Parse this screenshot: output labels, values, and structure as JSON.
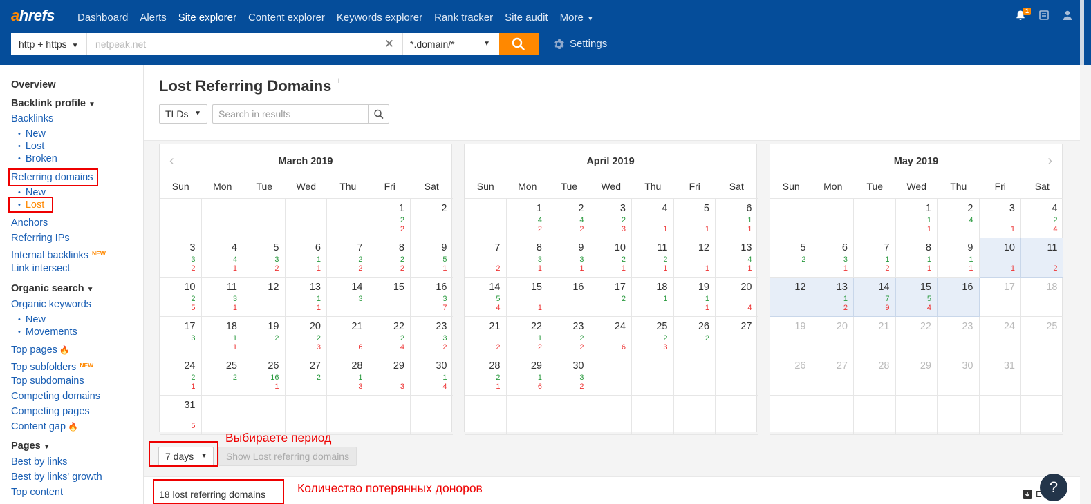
{
  "brand": {
    "logo_prefix": "a",
    "logo_rest": "hrefs"
  },
  "nav": [
    {
      "label": "Dashboard",
      "active": false
    },
    {
      "label": "Alerts",
      "active": false
    },
    {
      "label": "Site explorer",
      "active": true
    },
    {
      "label": "Content explorer",
      "active": false
    },
    {
      "label": "Keywords explorer",
      "active": false
    },
    {
      "label": "Rank tracker",
      "active": false
    },
    {
      "label": "Site audit",
      "active": false
    },
    {
      "label": "More",
      "active": false
    }
  ],
  "notifications": {
    "count": "1"
  },
  "searchbar": {
    "protocol": "http + https",
    "url_value": "netpeak.net",
    "mode": "*.domain/*",
    "settings_label": "Settings"
  },
  "sidebar": {
    "overview": "Overview",
    "backlink_profile": "Backlink profile",
    "backlinks": "Backlinks",
    "backlinks_new": "New",
    "backlinks_lost": "Lost",
    "backlinks_broken": "Broken",
    "referring_domains": "Referring domains",
    "rd_new": "New",
    "rd_lost": "Lost",
    "anchors": "Anchors",
    "referring_ips": "Referring IPs",
    "internal_backlinks": "Internal backlinks",
    "new_badge": "NEW",
    "link_intersect": "Link intersect",
    "organic_search": "Organic search",
    "organic_keywords": "Organic keywords",
    "ok_new": "New",
    "ok_movements": "Movements",
    "top_pages": "Top pages",
    "top_subfolders": "Top subfolders",
    "top_subdomains": "Top subdomains",
    "competing_domains": "Competing domains",
    "competing_pages": "Competing pages",
    "content_gap": "Content gap",
    "pages": "Pages",
    "best_by_links": "Best by links",
    "best_by_links_growth": "Best by links' growth",
    "top_content": "Top content"
  },
  "page": {
    "title": "Lost Referring Domains",
    "info_mark": "i",
    "tlds_label": "TLDs",
    "search_placeholder": "Search in results"
  },
  "calendar": {
    "weekdays": [
      "Sun",
      "Mon",
      "Tue",
      "Wed",
      "Thu",
      "Fri",
      "Sat"
    ],
    "months": [
      {
        "title": "March 2019",
        "days": [
          {
            "d": "1",
            "g": "2",
            "l": "2"
          },
          {
            "d": "2",
            "g": "",
            "l": ""
          },
          {
            "d": "3",
            "g": "3",
            "l": "2"
          },
          {
            "d": "4",
            "g": "4",
            "l": "1"
          },
          {
            "d": "5",
            "g": "3",
            "l": "2"
          },
          {
            "d": "6",
            "g": "1",
            "l": "1"
          },
          {
            "d": "7",
            "g": "2",
            "l": "2"
          },
          {
            "d": "8",
            "g": "2",
            "l": "2"
          },
          {
            "d": "9",
            "g": "5",
            "l": "1"
          },
          {
            "d": "10",
            "g": "2",
            "l": "5"
          },
          {
            "d": "11",
            "g": "3",
            "l": "1"
          },
          {
            "d": "12",
            "g": "",
            "l": ""
          },
          {
            "d": "13",
            "g": "1",
            "l": "1"
          },
          {
            "d": "14",
            "g": "3",
            "l": ""
          },
          {
            "d": "15",
            "g": "",
            "l": ""
          },
          {
            "d": "16",
            "g": "3",
            "l": "7"
          },
          {
            "d": "17",
            "g": "3",
            "l": ""
          },
          {
            "d": "18",
            "g": "1",
            "l": "1"
          },
          {
            "d": "19",
            "g": "2",
            "l": ""
          },
          {
            "d": "20",
            "g": "2",
            "l": "3"
          },
          {
            "d": "21",
            "g": "",
            "l": "6"
          },
          {
            "d": "22",
            "g": "2",
            "l": "4"
          },
          {
            "d": "23",
            "g": "3",
            "l": "2"
          },
          {
            "d": "24",
            "g": "2",
            "l": "1"
          },
          {
            "d": "25",
            "g": "2",
            "l": ""
          },
          {
            "d": "26",
            "g": "16",
            "l": "1"
          },
          {
            "d": "27",
            "g": "2",
            "l": ""
          },
          {
            "d": "28",
            "g": "1",
            "l": "3"
          },
          {
            "d": "29",
            "g": "",
            "l": "3"
          },
          {
            "d": "30",
            "g": "1",
            "l": "4"
          },
          {
            "d": "31",
            "g": "",
            "l": "5"
          }
        ]
      },
      {
        "title": "April 2019",
        "days": [
          {
            "d": "1",
            "g": "4",
            "l": "2"
          },
          {
            "d": "2",
            "g": "4",
            "l": "2"
          },
          {
            "d": "3",
            "g": "2",
            "l": "3"
          },
          {
            "d": "4",
            "g": "",
            "l": "1"
          },
          {
            "d": "5",
            "g": "",
            "l": "1"
          },
          {
            "d": "6",
            "g": "1",
            "l": "1"
          },
          {
            "d": "7",
            "g": "",
            "l": "2"
          },
          {
            "d": "8",
            "g": "3",
            "l": "1"
          },
          {
            "d": "9",
            "g": "3",
            "l": "1"
          },
          {
            "d": "10",
            "g": "2",
            "l": "1"
          },
          {
            "d": "11",
            "g": "2",
            "l": "1"
          },
          {
            "d": "12",
            "g": "",
            "l": "1"
          },
          {
            "d": "13",
            "g": "4",
            "l": "1"
          },
          {
            "d": "14",
            "g": "5",
            "l": "4"
          },
          {
            "d": "15",
            "g": "",
            "l": "1"
          },
          {
            "d": "16",
            "g": "",
            "l": ""
          },
          {
            "d": "17",
            "g": "2",
            "l": ""
          },
          {
            "d": "18",
            "g": "1",
            "l": ""
          },
          {
            "d": "19",
            "g": "1",
            "l": "1"
          },
          {
            "d": "20",
            "g": "",
            "l": "4"
          },
          {
            "d": "21",
            "g": "",
            "l": "2"
          },
          {
            "d": "22",
            "g": "1",
            "l": "2"
          },
          {
            "d": "23",
            "g": "2",
            "l": "2"
          },
          {
            "d": "24",
            "g": "",
            "l": "6"
          },
          {
            "d": "25",
            "g": "2",
            "l": "3"
          },
          {
            "d": "26",
            "g": "2",
            "l": ""
          },
          {
            "d": "27",
            "g": "",
            "l": ""
          },
          {
            "d": "28",
            "g": "2",
            "l": "1"
          },
          {
            "d": "29",
            "g": "1",
            "l": "6"
          },
          {
            "d": "30",
            "g": "3",
            "l": "2"
          }
        ]
      },
      {
        "title": "May 2019",
        "days": [
          {
            "d": "1",
            "g": "1",
            "l": "1"
          },
          {
            "d": "2",
            "g": "4",
            "l": ""
          },
          {
            "d": "3",
            "g": "",
            "l": "1"
          },
          {
            "d": "4",
            "g": "2",
            "l": "4"
          },
          {
            "d": "5",
            "g": "2",
            "l": ""
          },
          {
            "d": "6",
            "g": "3",
            "l": "1"
          },
          {
            "d": "7",
            "g": "1",
            "l": "2"
          },
          {
            "d": "8",
            "g": "1",
            "l": "1"
          },
          {
            "d": "9",
            "g": "1",
            "l": "1"
          },
          {
            "d": "10",
            "g": "",
            "l": "1",
            "sel": true
          },
          {
            "d": "11",
            "g": "",
            "l": "2",
            "sel": true
          },
          {
            "d": "12",
            "g": "",
            "l": "",
            "sel": true
          },
          {
            "d": "13",
            "g": "1",
            "l": "2",
            "sel": true
          },
          {
            "d": "14",
            "g": "7",
            "l": "9",
            "sel": true
          },
          {
            "d": "15",
            "g": "5",
            "l": "4",
            "sel": true
          },
          {
            "d": "16",
            "g": "",
            "l": "",
            "sel": true
          },
          {
            "d": "17",
            "dim": true
          },
          {
            "d": "18",
            "dim": true
          },
          {
            "d": "19",
            "dim": true
          },
          {
            "d": "20",
            "dim": true
          },
          {
            "d": "21",
            "dim": true
          },
          {
            "d": "22",
            "dim": true
          },
          {
            "d": "23",
            "dim": true
          },
          {
            "d": "24",
            "dim": true
          },
          {
            "d": "25",
            "dim": true
          },
          {
            "d": "26",
            "dim": true
          },
          {
            "d": "27",
            "dim": true
          },
          {
            "d": "28",
            "dim": true
          },
          {
            "d": "29",
            "dim": true
          },
          {
            "d": "30",
            "dim": true
          },
          {
            "d": "31",
            "dim": true
          }
        ]
      }
    ]
  },
  "period": {
    "label": "7 days",
    "show_button": "Show Lost referring domains"
  },
  "annotations": {
    "period": "Выбираете период",
    "count": "Количество потерянных доноров"
  },
  "results": {
    "count_label": "18 lost referring domains",
    "export_label": "E"
  },
  "help": {
    "label": "?"
  },
  "colors": {
    "topbar": "#054d9a",
    "accent": "#ff8800",
    "gain": "#2a9a3f",
    "loss": "#e33",
    "annotation": "#e00",
    "link": "#1a5fb4"
  }
}
